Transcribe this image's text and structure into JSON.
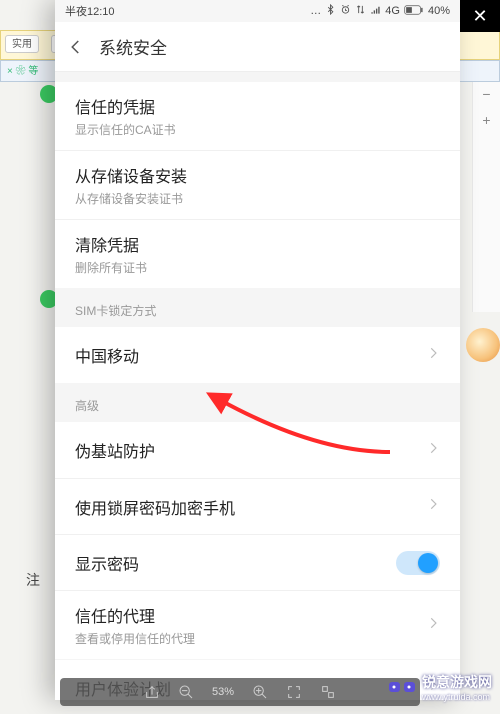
{
  "statusbar": {
    "time": "半夜12:10",
    "network": "4G",
    "battery": "40%"
  },
  "header": {
    "title": "系统安全"
  },
  "group1": {
    "row1": {
      "title": "信任的凭据",
      "sub": "显示信任的CA证书"
    },
    "row2": {
      "title": "从存储设备安装",
      "sub": "从存储设备安装证书"
    },
    "row3": {
      "title": "清除凭据",
      "sub": "删除所有证书"
    }
  },
  "section_sim": "SIM卡锁定方式",
  "group2": {
    "row1": {
      "title": "中国移动"
    }
  },
  "section_adv": "高级",
  "group3": {
    "row1": {
      "title": "伪基站防护"
    },
    "row2": {
      "title": "使用锁屏密码加密手机"
    },
    "row3": {
      "title": "显示密码"
    },
    "row4": {
      "title": "信任的代理",
      "sub": "查看或停用信任的代理"
    },
    "row5": {
      "title": "用户体验计划"
    }
  },
  "bottombar": {
    "zoom": "53%"
  },
  "watermark": {
    "text": "锐意游戏网",
    "url": "www.ytruida.com"
  },
  "note": "注"
}
